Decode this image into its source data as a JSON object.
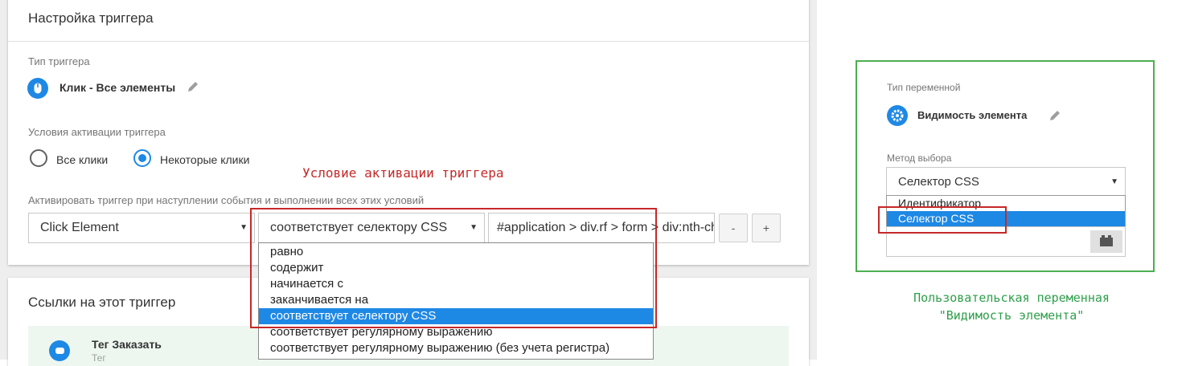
{
  "trigger_card": {
    "title": "Настройка триггера",
    "type_label": "Тип триггера",
    "type_value": "Клик - Все элементы",
    "activation_label": "Условия активации триггера",
    "radio_all": "Все клики",
    "radio_some": "Некоторые клики",
    "condition_label": "Активировать триггер при наступлении события и выполнении всех этих условий",
    "variable_select": "Click Element",
    "operator_select": "соответствует селектору CSS",
    "value_input": "#application > div.rf > form > div:nth-ch",
    "minus_button": "-",
    "plus_button": "+"
  },
  "operator_options": [
    "равно",
    "содержит",
    "начинается с",
    "заканчивается на",
    "соответствует селектору CSS",
    "соответствует регулярному выражению",
    "соответствует регулярному выражению (без учета регистра)"
  ],
  "operator_selected_index": 4,
  "annotation_trigger": "Условие активации триггера",
  "refs_card": {
    "title": "Ссылки на этот триггер",
    "tag_name": "Тег Заказать",
    "tag_sub": "Тег"
  },
  "variable_panel": {
    "type_label": "Тип переменной",
    "type_value": "Видимость элемента",
    "method_label": "Метод выбора",
    "method_select": "Селектор CSS",
    "options": [
      "Идентификатор",
      "Селектор CSS"
    ],
    "selected_index": 1
  },
  "annotation_variable_line1": "Пользовательская переменная",
  "annotation_variable_line2": "\"Видимость элемента\"",
  "colors": {
    "accent": "#1e88e5",
    "annotation_red": "#c62828",
    "annotation_green": "#2e9e4a"
  }
}
